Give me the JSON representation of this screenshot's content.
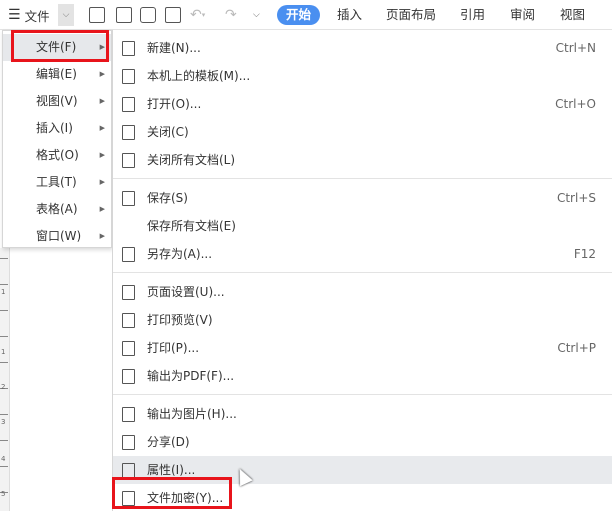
{
  "toolbar": {
    "menu_label": "文件",
    "tabs": [
      "开始",
      "插入",
      "页面布局",
      "引用",
      "审阅",
      "视图"
    ]
  },
  "left_menu": [
    {
      "label": "文件(F)"
    },
    {
      "label": "编辑(E)"
    },
    {
      "label": "视图(V)"
    },
    {
      "label": "插入(I)"
    },
    {
      "label": "格式(O)"
    },
    {
      "label": "工具(T)"
    },
    {
      "label": "表格(A)"
    },
    {
      "label": "窗口(W)"
    }
  ],
  "file_menu": {
    "group1": [
      {
        "label": "新建(N)...",
        "shortcut": "Ctrl+N",
        "icon": "new-doc-icon"
      },
      {
        "label": "本机上的模板(M)...",
        "shortcut": "",
        "icon": "template-icon"
      },
      {
        "label": "打开(O)...",
        "shortcut": "Ctrl+O",
        "icon": "folder-open-icon"
      },
      {
        "label": "关闭(C)",
        "shortcut": "",
        "icon": "close-doc-icon"
      },
      {
        "label": "关闭所有文档(L)",
        "shortcut": "",
        "icon": "close-all-icon"
      }
    ],
    "group2": [
      {
        "label": "保存(S)",
        "shortcut": "Ctrl+S",
        "icon": "save-icon"
      },
      {
        "label": "保存所有文档(E)",
        "shortcut": "",
        "icon": ""
      },
      {
        "label": "另存为(A)...",
        "shortcut": "F12",
        "icon": "save-as-icon"
      }
    ],
    "group3": [
      {
        "label": "页面设置(U)...",
        "shortcut": "",
        "icon": "page-setup-icon"
      },
      {
        "label": "打印预览(V)",
        "shortcut": "",
        "icon": "print-preview-icon"
      },
      {
        "label": "打印(P)...",
        "shortcut": "Ctrl+P",
        "icon": "print-icon"
      },
      {
        "label": "输出为PDF(F)...",
        "shortcut": "",
        "icon": "pdf-icon"
      }
    ],
    "group4": [
      {
        "label": "输出为图片(H)...",
        "shortcut": "",
        "icon": "image-icon"
      },
      {
        "label": "分享(D)",
        "shortcut": "",
        "icon": "share-icon"
      },
      {
        "label": "属性(I)...",
        "shortcut": "",
        "icon": "properties-icon"
      },
      {
        "label": "文件加密(Y)...",
        "shortcut": "",
        "icon": "encrypt-icon"
      }
    ]
  },
  "ruler_numbers": [
    "1",
    "1",
    "2",
    "3",
    "4",
    "5"
  ],
  "colors": {
    "accent": "#4a8ff0",
    "highlight": "#e8141b"
  }
}
